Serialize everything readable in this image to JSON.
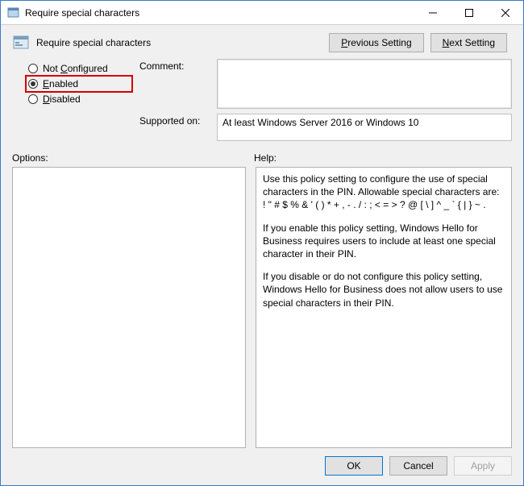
{
  "titlebar": {
    "title": "Require special characters"
  },
  "header": {
    "title": "Require special characters"
  },
  "nav": {
    "previous": "Previous Setting",
    "next": "Next Setting"
  },
  "radios": {
    "not_configured": "Not Configured",
    "enabled": "Enabled",
    "disabled": "Disabled",
    "selected": "enabled"
  },
  "field_labels": {
    "comment": "Comment:",
    "supported_on": "Supported on:"
  },
  "comment_value": "",
  "supported_on_value": "At least Windows Server 2016 or Windows 10",
  "sections": {
    "options": "Options:",
    "help": "Help:"
  },
  "help_paragraphs": [
    "Use this policy setting to configure the use of special characters in the PIN.  Allowable special characters are: ! \" # $ % & ' ( ) * + , - . / : ; < = > ? @ [ \\ ] ^ _ ` { | } ~ .",
    "If you enable this policy setting, Windows Hello for Business requires users to include at least one special character in their PIN.",
    "If you disable or do not configure this policy setting, Windows Hello for Business does not allow users to use special characters in their PIN."
  ],
  "footer": {
    "ok": "OK",
    "cancel": "Cancel",
    "apply": "Apply"
  }
}
